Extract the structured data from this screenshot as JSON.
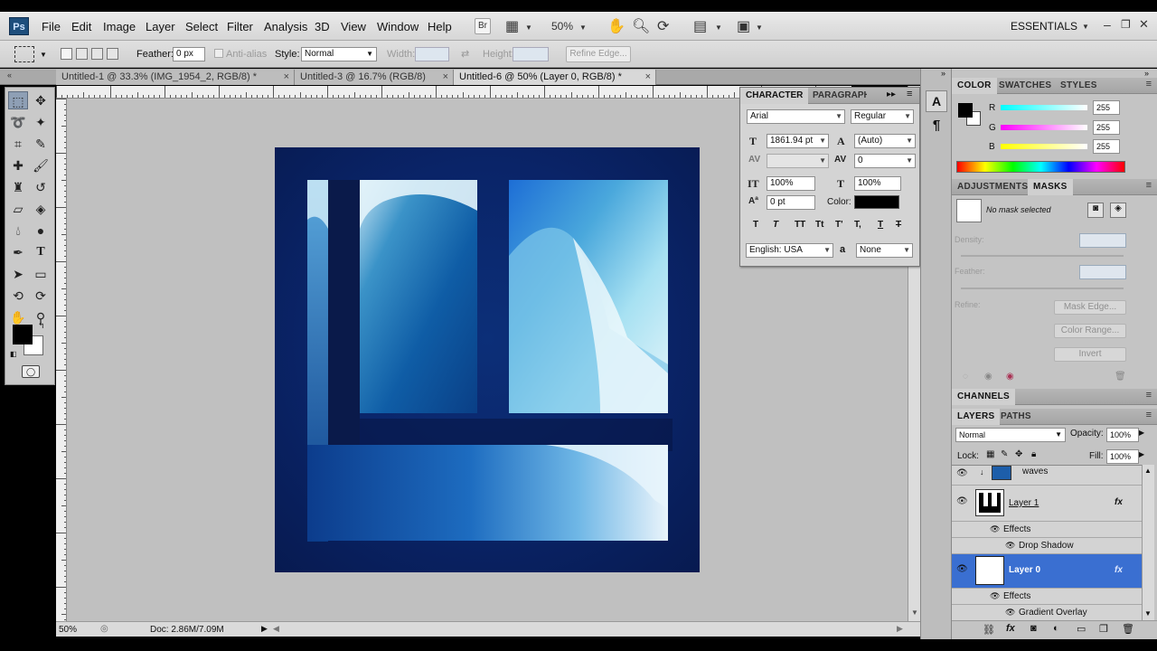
{
  "menubar": {
    "logo": "Ps",
    "items": [
      "File",
      "Edit",
      "Image",
      "Layer",
      "Select",
      "Filter",
      "Analysis",
      "3D",
      "View",
      "Window",
      "Help"
    ],
    "bridge_label": "Br",
    "zoom": "50%",
    "workspace": "ESSENTIALS"
  },
  "options": {
    "feather_label": "Feather:",
    "feather_value": "0 px",
    "antialias_label": "Anti-alias",
    "style_label": "Style:",
    "style_value": "Normal",
    "width_label": "Width:",
    "height_label": "Height:",
    "refine_edge": "Refine Edge..."
  },
  "tabs": [
    {
      "label": "Untitled-1 @ 33.3% (IMG_1954_2, RGB/8) *"
    },
    {
      "label": "Untitled-3 @ 16.7% (RGB/8)"
    },
    {
      "label": "Untitled-6 @ 50% (Layer 0, RGB/8) *"
    }
  ],
  "status": {
    "zoom": "50%",
    "doc": "Doc: 2.86M/7.09M"
  },
  "character": {
    "tab_character": "CHARACTER",
    "tab_paragraph": "PARAGRAPH",
    "font": "Arial",
    "style": "Regular",
    "size": "1861.94 pt",
    "leading": "(Auto)",
    "kerning": "",
    "tracking": "0",
    "vscale": "100%",
    "hscale": "100%",
    "baseline": "0 pt",
    "color_label": "Color:",
    "language": "English: USA",
    "aa_symbol": "a",
    "antialias": "None",
    "style_buttons": [
      "T",
      "T",
      "TT",
      "Tt",
      "T'",
      "T,",
      "T",
      "T"
    ]
  },
  "color_panel": {
    "tabs": [
      "COLOR",
      "SWATCHES",
      "STYLES"
    ],
    "r_label": "R",
    "g_label": "G",
    "b_label": "B",
    "r": "255",
    "g": "255",
    "b": "255"
  },
  "adjust_panel": {
    "tabs": [
      "ADJUSTMENTS",
      "MASKS"
    ],
    "no_mask": "No mask selected",
    "density": "Density:",
    "feather": "Feather:",
    "refine": "Refine:",
    "mask_edge": "Mask Edge...",
    "color_range": "Color Range...",
    "invert": "Invert"
  },
  "channels_panel": {
    "title": "CHANNELS"
  },
  "layers_panel": {
    "tabs": [
      "LAYERS",
      "PATHS"
    ],
    "blend_mode": "Normal",
    "opacity_label": "Opacity:",
    "opacity": "100%",
    "lock_label": "Lock:",
    "fill_label": "Fill:",
    "fill": "100%",
    "layers": [
      {
        "name": "waves"
      },
      {
        "name": "Layer 1",
        "effects_label": "Effects",
        "effect": "Drop Shadow",
        "fx": "fx"
      },
      {
        "name": "Layer 0",
        "effects_label": "Effects",
        "effect": "Gradient Overlay",
        "fx": "fx"
      }
    ]
  },
  "colors": {
    "accent": "#3a6fd1",
    "doc_bg": "#0a2468",
    "ui_gray": "#c4c4c4"
  }
}
